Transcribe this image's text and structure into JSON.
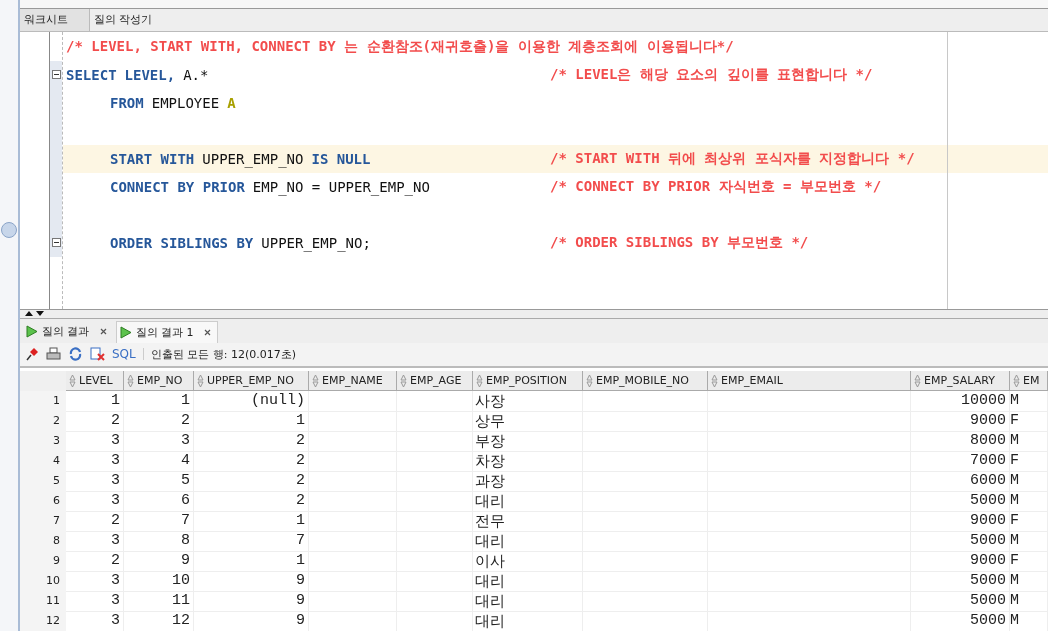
{
  "editor_tabs": [
    {
      "label": "워크시트",
      "selected": true
    },
    {
      "label": "질의 작성기",
      "selected": false
    }
  ],
  "code_lines": [
    {
      "fold": false,
      "current": false,
      "comment": "/* LEVEL, START WITH, CONNECT BY 는 순환참조(재귀호출)을 이용한 계층조회에 이용됩니다*/"
    },
    {
      "fold": true,
      "current": false,
      "tokens": [
        {
          "kind": "keyword",
          "text": "SELECT"
        },
        {
          "kind": "keyword",
          "text": "LEVEL,"
        },
        {
          "kind": "plain",
          "text": "A.*"
        }
      ],
      "comment": "/* LEVEL은 해당 요소의 깊이를 표현합니다 */"
    },
    {
      "fold": false,
      "current": false,
      "tokens": [
        {
          "kind": "keyword",
          "text": "FROM"
        },
        {
          "kind": "plain",
          "text": "EMPLOYEE"
        },
        {
          "kind": "alias",
          "text": "A"
        }
      ]
    },
    {
      "fold": false,
      "current": false
    },
    {
      "fold": false,
      "current": true,
      "tokens": [
        {
          "kind": "keyword",
          "text": "START WITH"
        },
        {
          "kind": "plain",
          "text": "UPPER_EMP_NO"
        },
        {
          "kind": "keyword",
          "text": "IS NULL"
        }
      ],
      "comment": "/* START WITH 뒤에 최상위 포식자를 지정합니다 */"
    },
    {
      "fold": false,
      "current": false,
      "tokens": [
        {
          "kind": "keyword",
          "text": "CONNECT BY PRIOR"
        },
        {
          "kind": "plain",
          "text": "EMP_NO = UPPER_EMP_NO"
        }
      ],
      "comment": "/* CONNECT BY PRIOR 자식번호 = 부모번호 */"
    },
    {
      "fold": false,
      "current": false
    },
    {
      "fold": true,
      "current": false,
      "tokens": [
        {
          "kind": "keyword",
          "text": "ORDER SIBLINGS BY"
        },
        {
          "kind": "plain",
          "text": "UPPER_EMP_NO;"
        }
      ],
      "comment": "/* ORDER SIBLINGS BY 부모번호 */"
    }
  ],
  "result_tabs": [
    {
      "label": "질의 결과",
      "selected": false
    },
    {
      "label": "질의 결과 1",
      "selected": true
    }
  ],
  "toolbar": {
    "sql_link": "SQL",
    "status": "인출된 모든 행: 12(0.017초)"
  },
  "columns": [
    "LEVEL",
    "EMP_NO",
    "UPPER_EMP_NO",
    "EMP_NAME",
    "EMP_AGE",
    "EMP_POSITION",
    "EMP_MOBILE_NO",
    "EMP_EMAIL",
    "EMP_SALARY",
    "EM"
  ],
  "rows": [
    {
      "num": "1",
      "level": "1",
      "emp_no": "1",
      "upper_emp_no": "(null)",
      "emp_position": "사장",
      "emp_salary": "10000",
      "column_10": "M"
    },
    {
      "num": "2",
      "level": "2",
      "emp_no": "2",
      "upper_emp_no": "1",
      "emp_position": "상무",
      "emp_salary": "9000",
      "column_10": "F"
    },
    {
      "num": "3",
      "level": "3",
      "emp_no": "3",
      "upper_emp_no": "2",
      "emp_position": "부장",
      "emp_salary": "8000",
      "column_10": "M"
    },
    {
      "num": "4",
      "level": "3",
      "emp_no": "4",
      "upper_emp_no": "2",
      "emp_position": "차장",
      "emp_salary": "7000",
      "column_10": "F"
    },
    {
      "num": "5",
      "level": "3",
      "emp_no": "5",
      "upper_emp_no": "2",
      "emp_position": "과장",
      "emp_salary": "6000",
      "column_10": "M"
    },
    {
      "num": "6",
      "level": "3",
      "emp_no": "6",
      "upper_emp_no": "2",
      "emp_position": "대리",
      "emp_salary": "5000",
      "column_10": "M"
    },
    {
      "num": "7",
      "level": "2",
      "emp_no": "7",
      "upper_emp_no": "1",
      "emp_position": "전무",
      "emp_salary": "9000",
      "column_10": "F"
    },
    {
      "num": "8",
      "level": "3",
      "emp_no": "8",
      "upper_emp_no": "7",
      "emp_position": "대리",
      "emp_salary": "5000",
      "column_10": "M"
    },
    {
      "num": "9",
      "level": "2",
      "emp_no": "9",
      "upper_emp_no": "1",
      "emp_position": "이사",
      "emp_salary": "9000",
      "column_10": "F"
    },
    {
      "num": "10",
      "level": "3",
      "emp_no": "10",
      "upper_emp_no": "9",
      "emp_position": "대리",
      "emp_salary": "5000",
      "column_10": "M"
    },
    {
      "num": "11",
      "level": "3",
      "emp_no": "11",
      "upper_emp_no": "9",
      "emp_position": "대리",
      "emp_salary": "5000",
      "column_10": "M"
    },
    {
      "num": "12",
      "level": "3",
      "emp_no": "12",
      "upper_emp_no": "9",
      "emp_position": "대리",
      "emp_salary": "5000",
      "column_10": "M"
    }
  ]
}
